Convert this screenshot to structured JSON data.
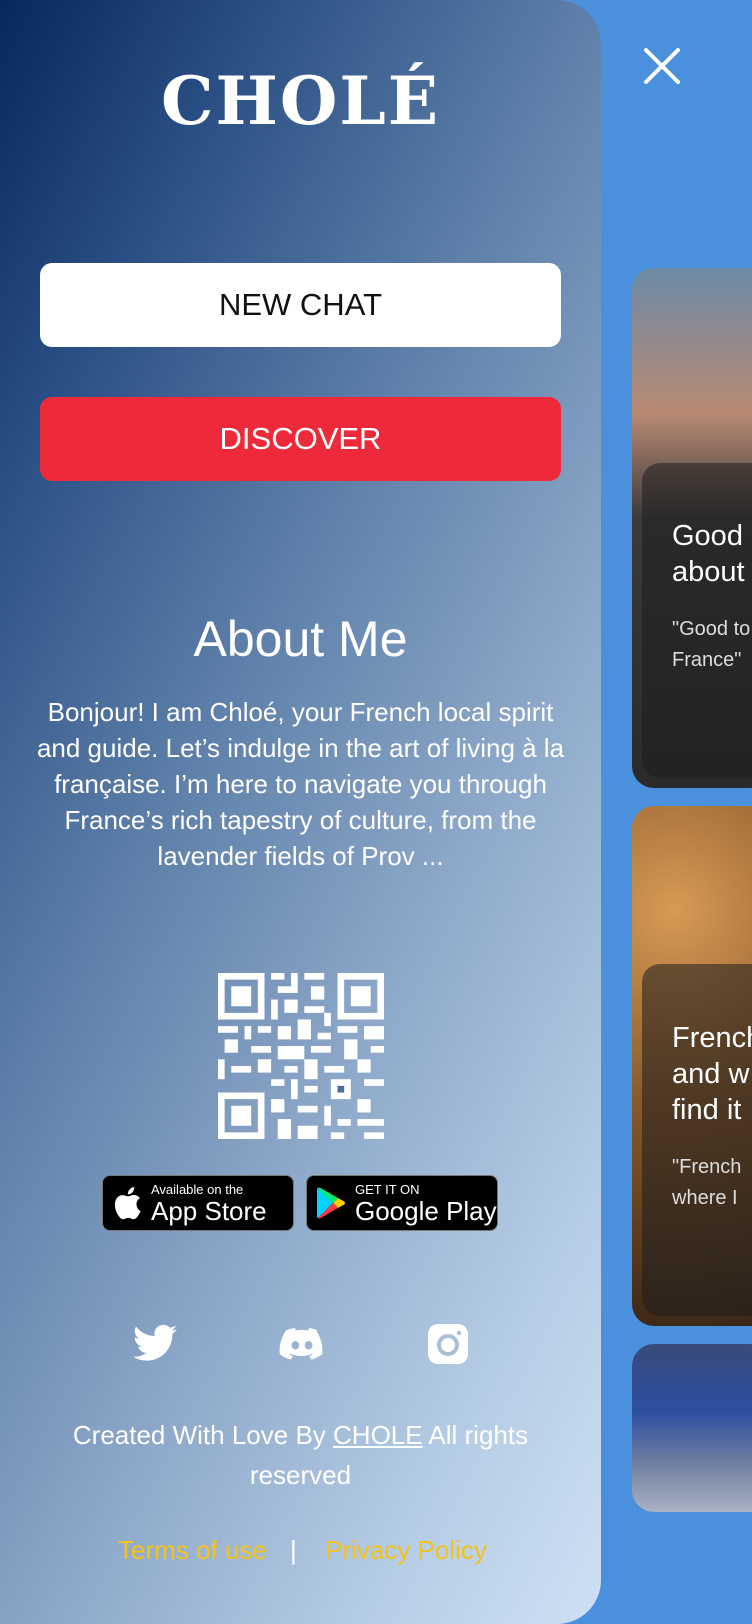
{
  "brand": {
    "logo_text": "CHOLÉ"
  },
  "menu": {
    "new_chat_label": "NEW CHAT",
    "discover_label": "DISCOVER"
  },
  "about": {
    "title": "About Me",
    "text": "Bonjour! I am Chloé, your French local spirit and guide. Let’s indulge in the art of living à la française. I’m here to navigate you through France’s rich tapestry of culture, from the lavender fields of Prov ..."
  },
  "stores": {
    "apple": {
      "small": "Available on the",
      "big": "App Store"
    },
    "google": {
      "small": "GET IT ON",
      "big": "Google Play"
    }
  },
  "social": [
    "twitter-icon",
    "discord-icon",
    "instagram-icon"
  ],
  "footer": {
    "prefix": "Created With Love By",
    "brand_link": "CHOLE",
    "suffix": "All rights reserved",
    "terms": "Terms of use",
    "separator": "|",
    "privacy": "Privacy Policy"
  },
  "cards": [
    {
      "title": "Good \nabout",
      "subtitle": "\"Good to\nFrance\""
    },
    {
      "title": "French\nand w\nfind it",
      "subtitle": "\"French\nwhere I"
    }
  ],
  "colors": {
    "discover": "#ee2a3a",
    "legal_links": "#f3c21b",
    "page_bg": "#4a90dd"
  }
}
